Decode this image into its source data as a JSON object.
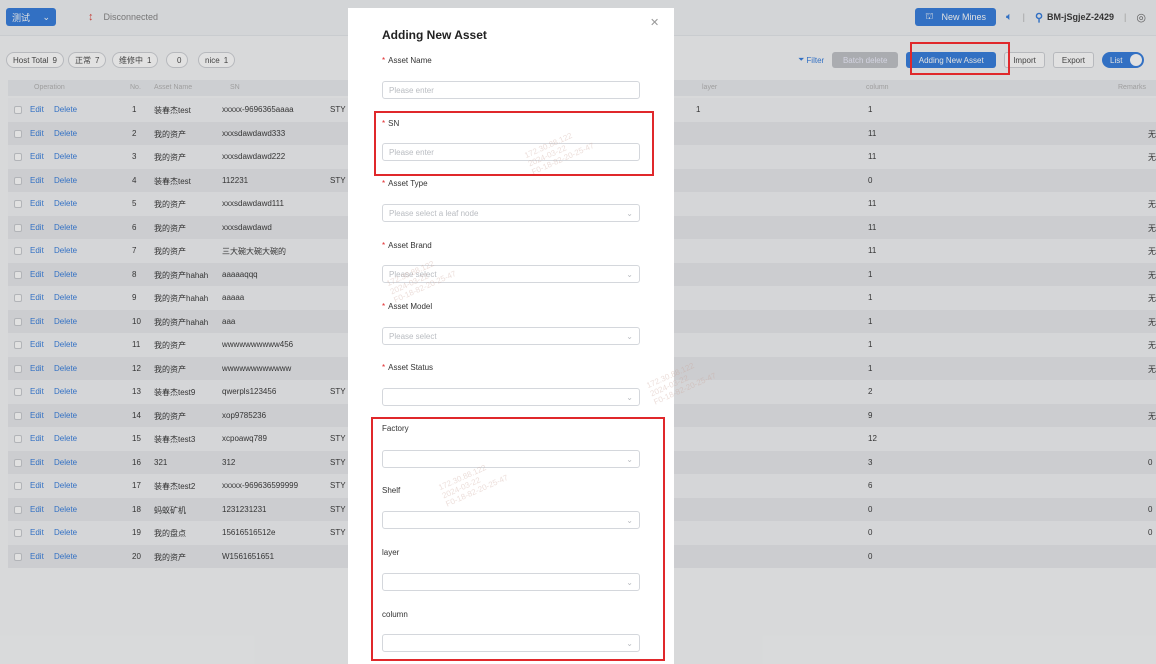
{
  "topbar": {
    "env_label": "测试",
    "connection_status": "Disconnected",
    "new_mines_label": "New Mines",
    "user_name": "BM-jSgjeZ-2429"
  },
  "stats": {
    "host_total_label": "Host Total",
    "host_total_value": "9",
    "normal_label": "正常",
    "normal_value": "7",
    "maintenance_label": "维修中",
    "maintenance_value": "1",
    "blank_value": "0",
    "nice_label": "nice",
    "nice_value": "1"
  },
  "toolbar": {
    "filter_label": "Filter",
    "batch_label": "Batch delete",
    "add_label": "Adding New Asset",
    "import_label": "Import",
    "export_label": "Export",
    "list_label": "List"
  },
  "table": {
    "headers": {
      "operation": "Operation",
      "no": "No.",
      "asset_name": "Asset Name",
      "sn": "SN",
      "layer": "layer",
      "column": "column",
      "remarks": "Remarks"
    },
    "edit_label": "Edit",
    "delete_label": "Delete",
    "rows": [
      {
        "no": "1",
        "name": "装春杰test",
        "sn": "xxxxx-9696365aaaa",
        "sty": "STY",
        "layer": "1",
        "column": "1",
        "remark": ""
      },
      {
        "no": "2",
        "name": "我的资产",
        "sn": "xxxsdawdawd333",
        "sty": "",
        "layer": "",
        "column": "11",
        "remark": "无"
      },
      {
        "no": "3",
        "name": "我的资产",
        "sn": "xxxsdawdawd222",
        "sty": "",
        "layer": "",
        "column": "11",
        "remark": "无"
      },
      {
        "no": "4",
        "name": "装春杰test",
        "sn": "112231",
        "sty": "STY",
        "layer": "",
        "column": "0",
        "remark": ""
      },
      {
        "no": "5",
        "name": "我的资产",
        "sn": "xxxsdawdawd111",
        "sty": "",
        "layer": "",
        "column": "11",
        "remark": "无"
      },
      {
        "no": "6",
        "name": "我的资产",
        "sn": "xxxsdawdawd",
        "sty": "",
        "layer": "",
        "column": "11",
        "remark": "无"
      },
      {
        "no": "7",
        "name": "我的资产",
        "sn": "三大碗大碗大碗的",
        "sty": "",
        "layer": "",
        "column": "11",
        "remark": "无"
      },
      {
        "no": "8",
        "name": "我的资产hahah",
        "sn": "aaaaaqqq",
        "sty": "",
        "layer": "",
        "column": "1",
        "remark": "无"
      },
      {
        "no": "9",
        "name": "我的资产hahah",
        "sn": "aaaaa",
        "sty": "",
        "layer": "",
        "column": "1",
        "remark": "无"
      },
      {
        "no": "10",
        "name": "我的资产hahah",
        "sn": "aaa",
        "sty": "",
        "layer": "",
        "column": "1",
        "remark": "无"
      },
      {
        "no": "11",
        "name": "我的资产",
        "sn": "wwwwwwwwww456",
        "sty": "",
        "layer": "",
        "column": "1",
        "remark": "无"
      },
      {
        "no": "12",
        "name": "我的资产",
        "sn": "wwwwwwwwwwww",
        "sty": "",
        "layer": "",
        "column": "1",
        "remark": "无"
      },
      {
        "no": "13",
        "name": "装春杰test9",
        "sn": "qwerpls123456",
        "sty": "STY",
        "layer": "",
        "column": "2",
        "remark": ""
      },
      {
        "no": "14",
        "name": "我的资产",
        "sn": "xop9785236",
        "sty": "",
        "layer": "",
        "column": "9",
        "remark": "无"
      },
      {
        "no": "15",
        "name": "装春杰test3",
        "sn": "xcpoawq789",
        "sty": "STY",
        "layer": "",
        "column": "12",
        "remark": ""
      },
      {
        "no": "16",
        "name": "321",
        "sn": "312",
        "sty": "STY",
        "layer": "",
        "column": "3",
        "remark": "0"
      },
      {
        "no": "17",
        "name": "装春杰test2",
        "sn": "xxxxx-969636599999",
        "sty": "STY",
        "layer": "",
        "column": "6",
        "remark": ""
      },
      {
        "no": "18",
        "name": "蚂蚁矿机",
        "sn": "1231231231",
        "sty": "STY",
        "layer": "",
        "column": "0",
        "remark": "0"
      },
      {
        "no": "19",
        "name": "我的盘点",
        "sn": "15616516512e",
        "sty": "STY",
        "layer": "",
        "column": "0",
        "remark": "0"
      },
      {
        "no": "20",
        "name": "我的资产",
        "sn": "W1561651651",
        "sty": "",
        "layer": "",
        "column": "0",
        "remark": ""
      }
    ]
  },
  "modal": {
    "title": "Adding New Asset",
    "fields": {
      "asset_name": {
        "label": "Asset Name",
        "placeholder": "Please enter"
      },
      "sn": {
        "label": "SN",
        "placeholder": "Please enter"
      },
      "asset_type": {
        "label": "Asset Type",
        "placeholder": "Please select a leaf node"
      },
      "asset_brand": {
        "label": "Asset Brand",
        "placeholder": "Please select"
      },
      "asset_model": {
        "label": "Asset Model",
        "placeholder": "Please select"
      },
      "asset_status": {
        "label": "Asset Status",
        "placeholder": ""
      },
      "factory": {
        "label": "Factory",
        "placeholder": ""
      },
      "shelf": {
        "label": "Shelf",
        "placeholder": ""
      },
      "layer": {
        "label": "layer",
        "placeholder": ""
      },
      "column": {
        "label": "column",
        "placeholder": ""
      }
    },
    "required_mark": "*"
  },
  "watermark": "172.30.88.122\n2024-03-22\nF0-18-82-20-25-47",
  "colors": {
    "accent": "#1f6fd9",
    "highlight": "#e0282b",
    "required": "#e0282b"
  }
}
